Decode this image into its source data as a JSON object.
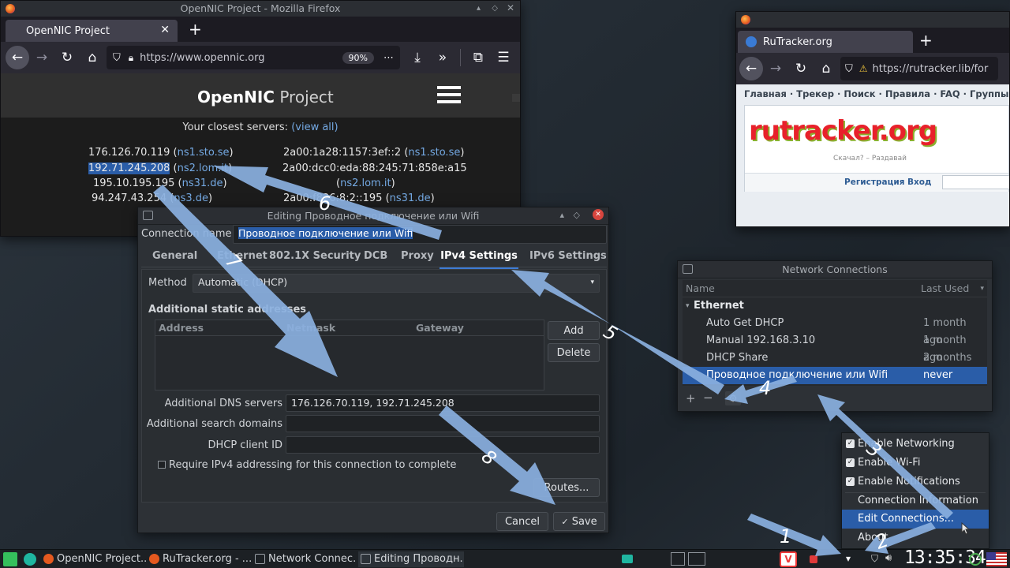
{
  "firefox1": {
    "title": "OpenNIC Project - Mozilla Firefox",
    "tab": "OpenNIC Project",
    "url": "https://www.opennic.org",
    "zoom": "90%",
    "site_brand_bold": "OpenNIC",
    "site_brand_light": "Project",
    "closest_label": "Your closest servers:",
    "view_all": "(view all)",
    "servers_left": [
      {
        "ip": "176.126.70.119",
        "host": "ns1.sto.se"
      },
      {
        "ip": "192.71.245.208",
        "host": "ns2.lom.it"
      },
      {
        "ip": "195.10.195.195",
        "host": "ns31.de"
      },
      {
        "ip": "94.247.43.254",
        "host": "ns3.de"
      }
    ],
    "servers_right": [
      {
        "ip": "2a00:1a28:1157:3ef::2",
        "host": "ns1.sto.se"
      },
      {
        "ip": "2a00:dcc0:eda:88:245:71:858e:a15",
        "host": ""
      },
      {
        "ip": "",
        "host": "ns2.lom.it"
      },
      {
        "ip": "2a00:f826:8:2::195",
        "host": "ns31.de"
      }
    ]
  },
  "firefox2": {
    "tab": "RuTracker.org",
    "url": "https://rutracker.lib/for",
    "nav": "Главная · Трекер · Поиск · Правила · FAQ · Группы",
    "logo": "rutracker.org",
    "slogan": "Скачал? – Раздавай",
    "register": "Регистрация",
    "login": "Вход"
  },
  "editor": {
    "title": "Editing Проводное подключение или Wifi",
    "conn_label": "Connection name:",
    "conn_value": "Проводное подключение или Wifi",
    "tabs": [
      "General",
      "Ethernet",
      "802.1X Security",
      "DCB",
      "Proxy",
      "IPv4 Settings",
      "IPv6 Settings"
    ],
    "method_label": "Method",
    "method_value": "Automatic (DHCP)",
    "static_label": "Additional static addresses",
    "col_address": "Address",
    "col_netmask": "Netmask",
    "col_gateway": "Gateway",
    "add": "Add",
    "delete": "Delete",
    "dns_label": "Additional DNS servers",
    "dns_value": "176.126.70.119, 192.71.245.208",
    "search_label": "Additional search domains",
    "dhcp_label": "DHCP client ID",
    "require_label": "Require IPv4 addressing for this connection to complete",
    "routes": "Routes...",
    "cancel": "Cancel",
    "save": "Save"
  },
  "netconn": {
    "title": "Network Connections",
    "col_name": "Name",
    "col_last": "Last Used",
    "group": "Ethernet",
    "rows": [
      {
        "name": "Auto Get DHCP",
        "last": "1 month ago"
      },
      {
        "name": "Manual 192.168.3.10",
        "last": "1 month ago"
      },
      {
        "name": "DHCP Share",
        "last": "2 months ago"
      },
      {
        "name": "Проводное подключение или Wifi",
        "last": "never"
      }
    ]
  },
  "traymenu": {
    "items": [
      "Enable Networking",
      "Enable Wi-Fi",
      "Enable Notifications",
      "Connection Information",
      "Edit Connections...",
      "About"
    ]
  },
  "taskbar": {
    "items": [
      "OpenNIC Project...",
      "RuTracker.org - ...",
      "Network Connec...",
      "Editing Проводн..."
    ],
    "clock": "13:35:34"
  },
  "arrow_labels": [
    "1",
    "2",
    "3",
    "4",
    "5",
    "6",
    "7",
    "8"
  ],
  "colors": {
    "selection": "#2a5da8",
    "accent": "#3d7bd6",
    "arrow": "#8ab0e0"
  }
}
